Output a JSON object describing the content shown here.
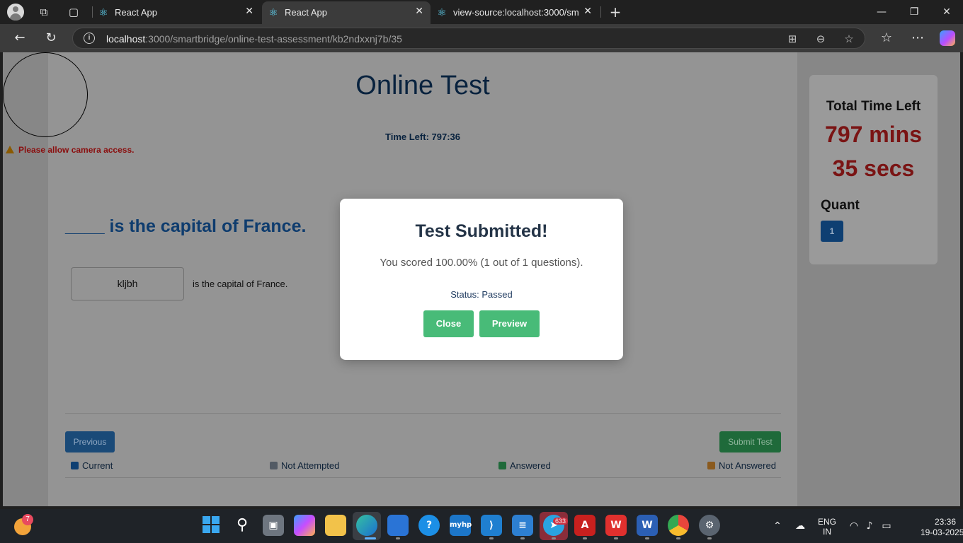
{
  "browser": {
    "tabs": [
      {
        "title": "React App",
        "active": false
      },
      {
        "title": "React App",
        "active": true
      },
      {
        "title": "view-source:localhost:3000/smartb",
        "active": false
      }
    ],
    "new_tab_label": "+",
    "url_host": "localhost",
    "url_path": ":3000/smartbridge/online-test-assessment/kb2ndxxnj7b/35"
  },
  "camera": {
    "warning": "Please allow camera access."
  },
  "test": {
    "title": "Online Test",
    "time_left": "Time Left: 797:36",
    "question": "____ is the capital of France.",
    "answer_value": "kljbh",
    "answer_suffix": "is the capital of France.",
    "previous_label": "Previous",
    "submit_label": "Submit Test",
    "legend": [
      {
        "label": "Current",
        "color": "#0e3f72"
      },
      {
        "label": "Not Attempted",
        "color": "#525a64"
      },
      {
        "label": "Answered",
        "color": "#1f6a3a"
      },
      {
        "label": "Not Answered",
        "color": "#8a5a1e"
      }
    ]
  },
  "sidebar": {
    "title": "Total Time Left",
    "mins": "797 mins",
    "secs": "35 secs",
    "section": "Quant",
    "question_number": "1"
  },
  "modal": {
    "title": "Test Submitted!",
    "score": "You scored 100.00% (1 out of 1 questions).",
    "status": "Status: Passed",
    "close_label": "Close",
    "preview_label": "Preview"
  },
  "taskbar": {
    "weather_badge": "7",
    "telegram_badge": "633",
    "lang_line1": "ENG",
    "lang_line2": "IN",
    "time": "23:36",
    "date": "19-03-2025"
  },
  "colors": {
    "accent_blue": "#1a4a78",
    "accent_green": "#48bb78",
    "timer_red": "#7a1414",
    "title_navy": "#08223e"
  }
}
